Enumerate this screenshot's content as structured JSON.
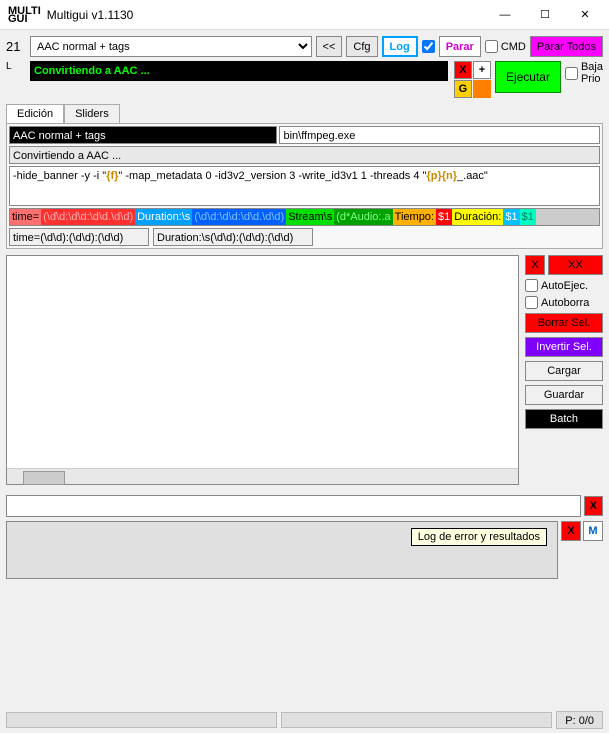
{
  "window": {
    "title": "Multigui v1.1130",
    "logo_l1": "MULTI",
    "logo_l2": "GUI"
  },
  "top": {
    "num": "21",
    "L": "L",
    "preset": "AAC normal + tags",
    "back": "<<",
    "cfg": "Cfg",
    "log": "Log",
    "parar": "Parar",
    "cmd": "CMD",
    "parar_todos": "Parar Todos"
  },
  "status": "Convirtiendo a AAC ...",
  "iconstrip": {
    "x": "X",
    "plus": "+",
    "g": "G"
  },
  "exec": {
    "label": "Ejecutar",
    "baja1": "Baja",
    "baja2": "Prio"
  },
  "tabs": {
    "edicion": "Edición",
    "sliders": "Sliders"
  },
  "fields": {
    "preset_name": "AAC normal + tags",
    "exe": "bin\\ffmpeg.exe",
    "status2": "Convirtiendo a AAC ...",
    "args": "-hide_banner -y -i \"{f}\" -map_metadata 0 -id3v2_version 3 -write_id3v1 1 -threads 4 \"{p}{n}_.aac\""
  },
  "regex1": {
    "time_lbl": "time=",
    "time_re": "(\\d\\d:\\d\\d:\\d\\d.\\d\\d)",
    "dur_lbl": "Duration:\\s",
    "dur_re": "(\\d\\d:\\d\\d:\\d\\d.\\d\\d)",
    "stream_lbl": "Stream\\s",
    "stream_re": "(d*Audio:.a",
    "tiempo_lbl": "Tiempo: ",
    "tiempo_v": "$1",
    "duracion_lbl": "Duración: ",
    "duracion_v1": "$1",
    "duracion_v2": "$1"
  },
  "regex2": {
    "time": "time=(\\d\\d):(\\d\\d):(\\d\\d)",
    "dur": "Duration:\\s(\\d\\d):(\\d\\d):(\\d\\d)"
  },
  "side": {
    "x": "X",
    "xx": "XX",
    "autoejec": "AutoEjec.",
    "autoborra": "Autoborra",
    "borrar": "Borrar Sel.",
    "invertir": "Invertir Sel.",
    "cargar": "Cargar",
    "guardar": "Guardar",
    "batch": "Batch"
  },
  "bottom": {
    "x1": "X",
    "x2": "X",
    "m": "M",
    "tooltip": "Log de error y resultados"
  },
  "footer": {
    "progress": "P: 0/0"
  }
}
